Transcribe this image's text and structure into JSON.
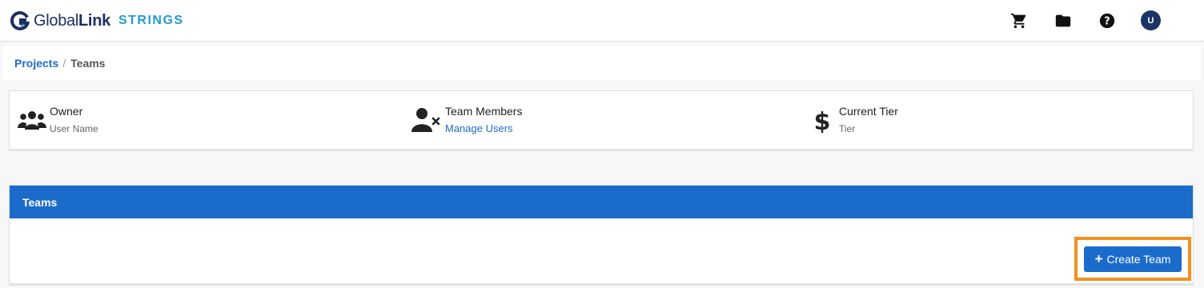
{
  "app": {
    "brand_name_regular": "Global",
    "brand_name_bold": "Link",
    "brand_product": "STRINGS"
  },
  "header": {
    "icons": [
      "cart-icon",
      "folder-icon",
      "help-icon"
    ],
    "avatar_initial": "U"
  },
  "breadcrumb": {
    "root": "Projects",
    "separator": "/",
    "current": "Teams"
  },
  "info": {
    "owner": {
      "label": "Owner",
      "value": "User Name",
      "icon": "users-icon"
    },
    "members": {
      "label": "Team Members",
      "link": "Manage Users",
      "icon": "user-remove-icon"
    },
    "tier": {
      "label": "Current Tier",
      "value": "Tier",
      "icon": "dollar-icon"
    }
  },
  "teams": {
    "header": "Teams",
    "create_label": "Create Team"
  },
  "colors": {
    "primary": "#1b6bcb",
    "brand_navy": "#1c2f63",
    "brand_cyan": "#1f9bd7",
    "highlight": "#f2901e"
  }
}
